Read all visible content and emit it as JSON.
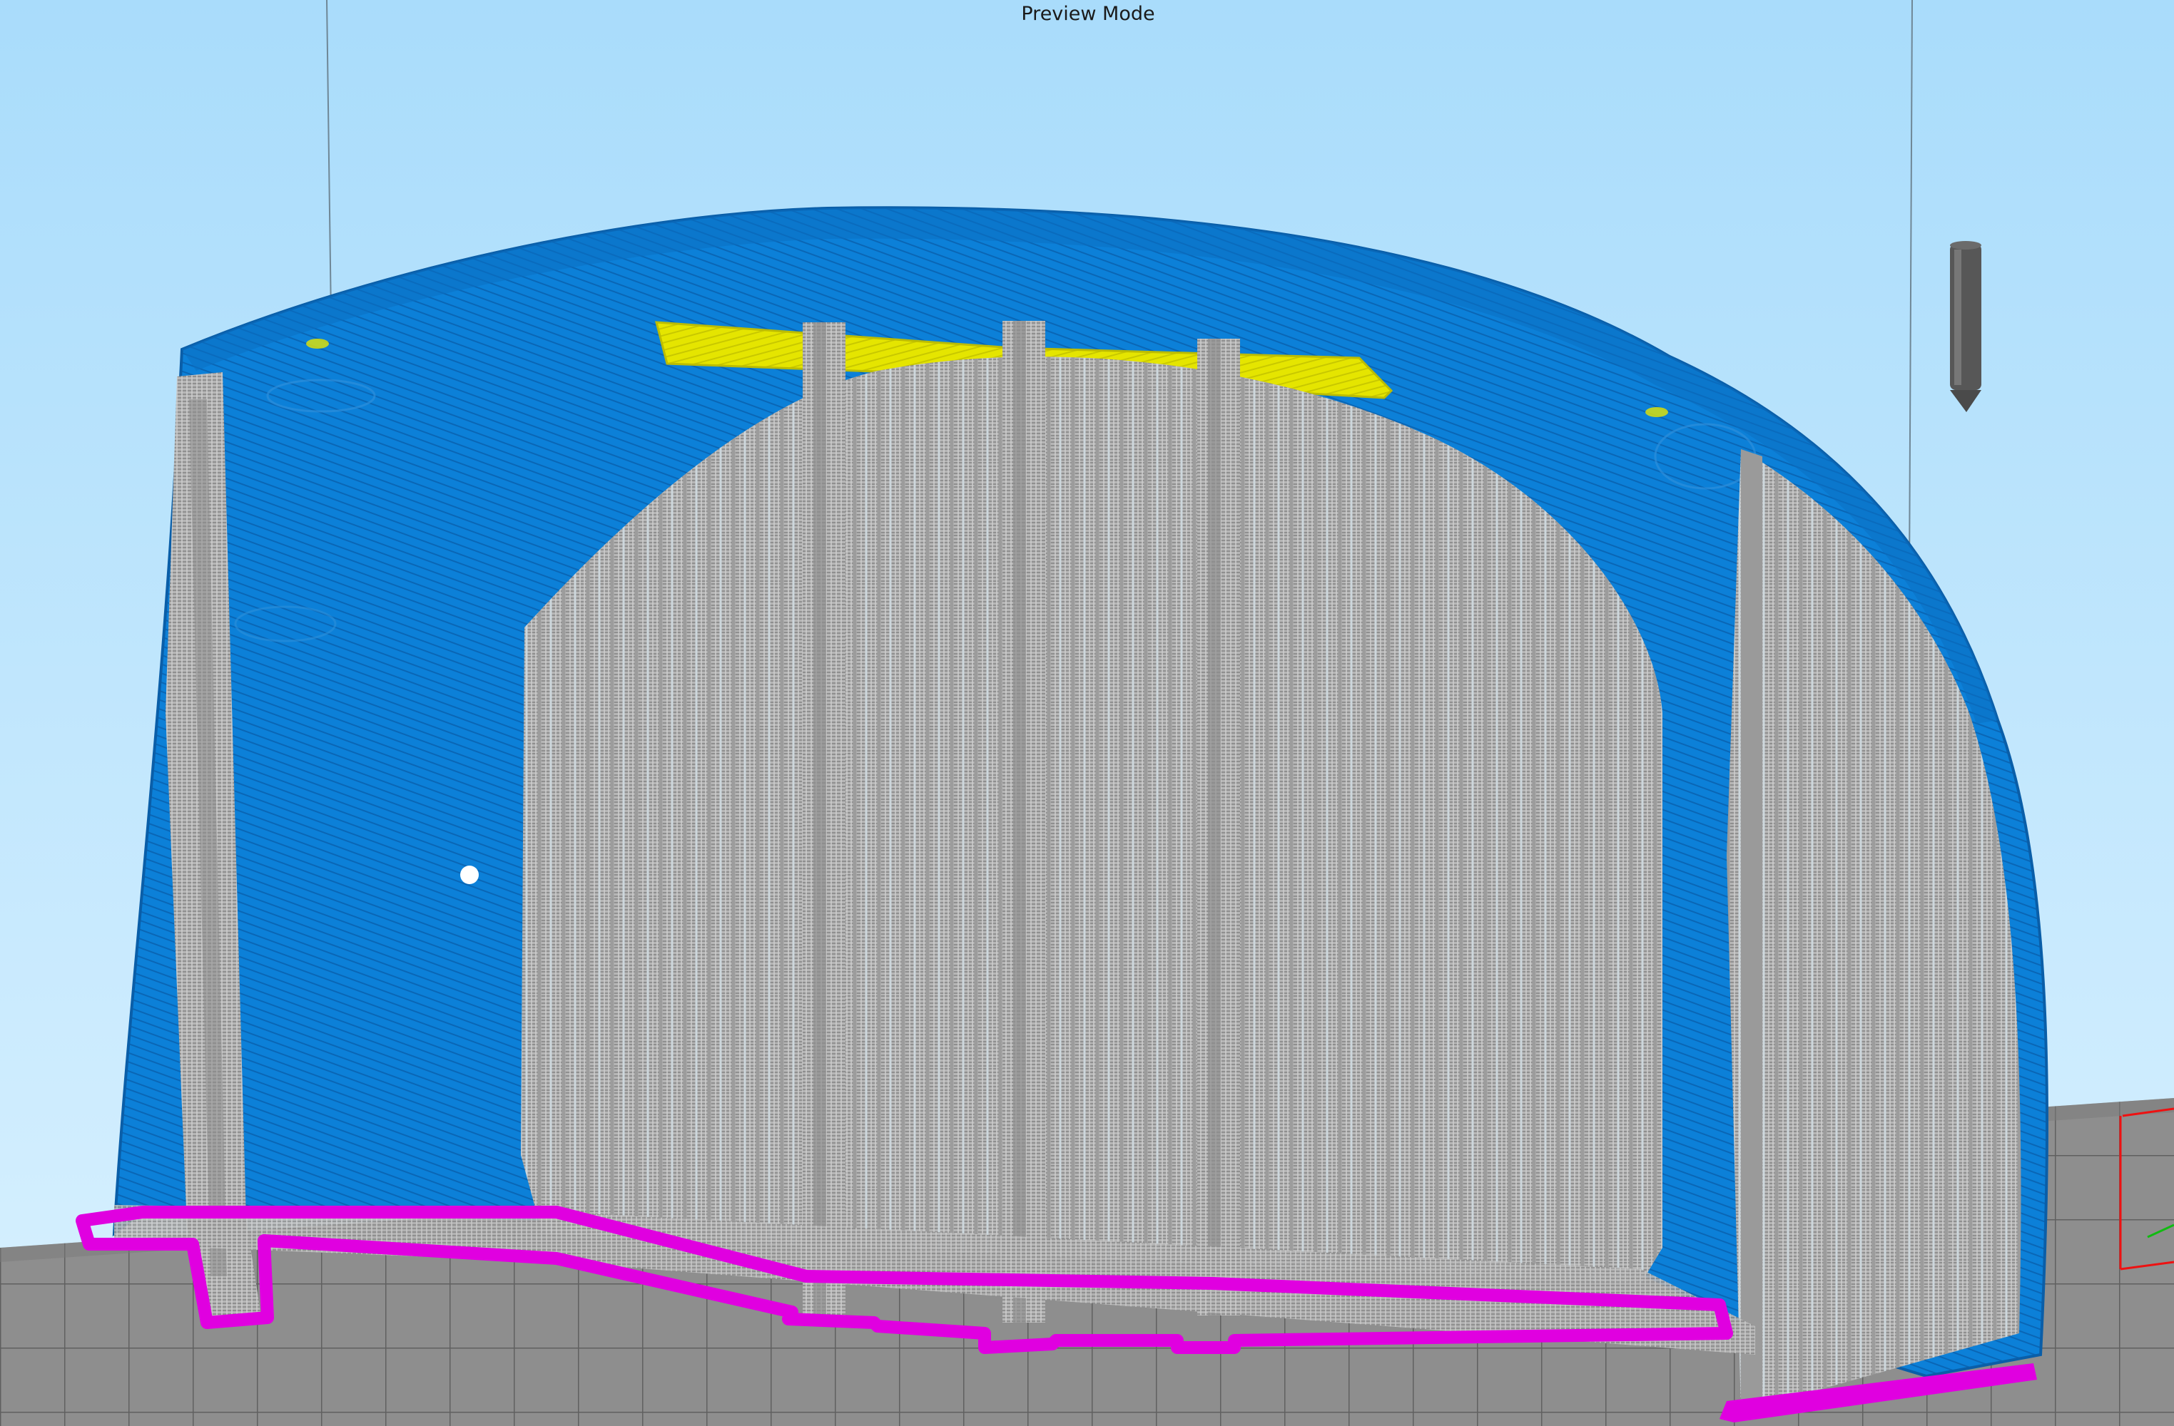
{
  "viewport": {
    "mode_label": "Preview Mode"
  },
  "scene": {
    "background_top_color": "#a9dcfb",
    "background_bottom_color": "#d9f1ff",
    "bed_color": "#8c8c8c",
    "bed_grid_color": "#5e5e5e",
    "outer_shell_color": "#0a7ed6",
    "support_color": "#b4b4b4",
    "top_solid_infill_color": "#e6e600",
    "brim_color": "#e000e0",
    "nozzle_color": "#555555",
    "axis_x_color": "#ee1111",
    "axis_y_color": "#11bb11",
    "nozzle_icon": "nozzle-icon",
    "axis_icon": "axis-gizmo-icon"
  }
}
